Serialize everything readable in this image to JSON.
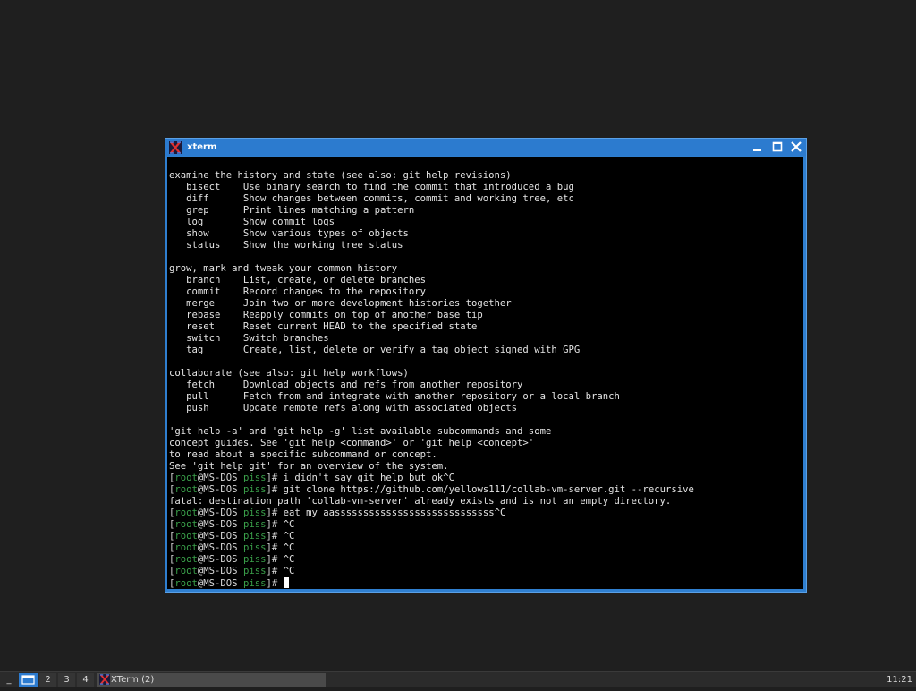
{
  "window": {
    "title": "xterm"
  },
  "terminal": {
    "lines": [
      {
        "text": "examine the history and state (see also: git help revisions)"
      },
      {
        "text": "   bisect    Use binary search to find the commit that introduced a bug"
      },
      {
        "text": "   diff      Show changes between commits, commit and working tree, etc"
      },
      {
        "text": "   grep      Print lines matching a pattern"
      },
      {
        "text": "   log       Show commit logs"
      },
      {
        "text": "   show      Show various types of objects"
      },
      {
        "text": "   status    Show the working tree status"
      },
      {
        "text": ""
      },
      {
        "text": "grow, mark and tweak your common history"
      },
      {
        "text": "   branch    List, create, or delete branches"
      },
      {
        "text": "   commit    Record changes to the repository"
      },
      {
        "text": "   merge     Join two or more development histories together"
      },
      {
        "text": "   rebase    Reapply commits on top of another base tip"
      },
      {
        "text": "   reset     Reset current HEAD to the specified state"
      },
      {
        "text": "   switch    Switch branches"
      },
      {
        "text": "   tag       Create, list, delete or verify a tag object signed with GPG"
      },
      {
        "text": ""
      },
      {
        "text": "collaborate (see also: git help workflows)"
      },
      {
        "text": "   fetch     Download objects and refs from another repository"
      },
      {
        "text": "   pull      Fetch from and integrate with another repository or a local branch"
      },
      {
        "text": "   push      Update remote refs along with associated objects"
      },
      {
        "text": ""
      },
      {
        "text": "'git help -a' and 'git help -g' list available subcommands and some"
      },
      {
        "text": "concept guides. See 'git help <command>' or 'git help <concept>'"
      },
      {
        "text": "to read about a specific subcommand or concept."
      },
      {
        "text": "See 'git help git' for an overview of the system."
      },
      {
        "prompt": true,
        "user": "root",
        "host": "MS-DOS",
        "dir": "piss",
        "cmd": "i didn't say git help but ok^C"
      },
      {
        "prompt": true,
        "user": "root",
        "host": "MS-DOS",
        "dir": "piss",
        "cmd": "git clone https://github.com/yellows111/collab-vm-server.git --recursive"
      },
      {
        "text": "fatal: destination path 'collab-vm-server' already exists and is not an empty directory."
      },
      {
        "prompt": true,
        "user": "root",
        "host": "MS-DOS",
        "dir": "piss",
        "cmd": "eat my aassssssssssssssssssssssssssss^C"
      },
      {
        "prompt": true,
        "user": "root",
        "host": "MS-DOS",
        "dir": "piss",
        "cmd": "^C"
      },
      {
        "prompt": true,
        "user": "root",
        "host": "MS-DOS",
        "dir": "piss",
        "cmd": "^C"
      },
      {
        "prompt": true,
        "user": "root",
        "host": "MS-DOS",
        "dir": "piss",
        "cmd": "^C"
      },
      {
        "prompt": true,
        "user": "root",
        "host": "MS-DOS",
        "dir": "piss",
        "cmd": "^C"
      },
      {
        "prompt": true,
        "user": "root",
        "host": "MS-DOS",
        "dir": "piss",
        "cmd": "^C"
      },
      {
        "prompt": true,
        "user": "root",
        "host": "MS-DOS",
        "dir": "piss",
        "cmd": "",
        "cursor": true
      }
    ]
  },
  "taskbar": {
    "menu_label": "_",
    "desktops": [
      "2",
      "3",
      "4"
    ],
    "task_label": "XTerm (2)",
    "clock": "11:21"
  },
  "colors": {
    "titlebar": "#2c7bcf",
    "prompt_green": "#3aa04a",
    "terminal_bg": "#000000"
  },
  "icons": {
    "app": "xterm-icon",
    "minimize": "minimize-icon",
    "maximize": "maximize-icon",
    "close": "close-icon",
    "desktop_active": "desktop-icon"
  }
}
